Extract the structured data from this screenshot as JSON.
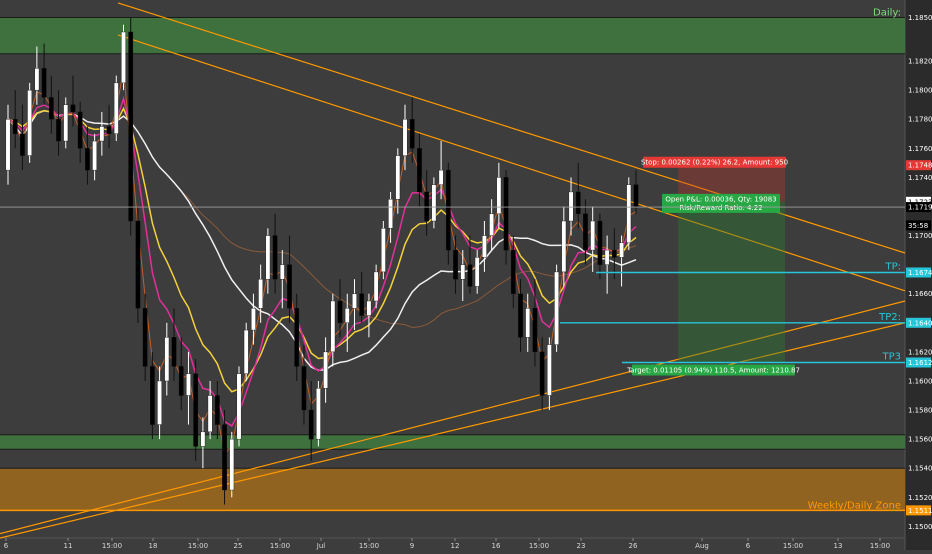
{
  "chart_data": {
    "type": "candlestick",
    "symbol_timeframe_hint": "",
    "y_range": [
      1.1492,
      1.1862
    ],
    "x_ticks": [
      "6",
      "11",
      "15:00",
      "18",
      "21",
      "15:00",
      "25",
      "28",
      "Jul",
      "15:00",
      "9",
      "12",
      "16",
      "15:00",
      "23",
      "26",
      "Aug",
      "6",
      "9",
      "15:00",
      "13",
      "16",
      "15:00"
    ],
    "y_ticks": [
      "1.18500",
      "1.18200",
      "1.18000",
      "1.17800",
      "1.17600",
      "1.17400",
      "1.17200",
      "1.17000",
      "1.16600",
      "1.16400",
      "1.16200",
      "1.16000",
      "1.15800",
      "1.15600",
      "1.15400",
      "1.15200",
      "1.15000"
    ],
    "price_labels": [
      {
        "text": "1.17484",
        "value": 1.17484,
        "color": "#e53935",
        "text_color": "#ffffff"
      },
      {
        "text": "1.17232",
        "value": 1.17232,
        "color": "#ffffff",
        "text_color": "#000000"
      },
      {
        "text": "1.17196",
        "value": 1.17196,
        "color": "#000000",
        "text_color": "#ffffff"
      },
      {
        "text": "35:58",
        "value": 1.1707,
        "color": "#000000",
        "text_color": "#ffffff"
      },
      {
        "text": "1.16746",
        "value": 1.16746,
        "color": "#26c6da",
        "text_color": "#ffffff"
      },
      {
        "text": "1.16400",
        "value": 1.164,
        "color": "#26c6da",
        "text_color": "#ffffff"
      },
      {
        "text": "1.16127",
        "value": 1.16127,
        "color": "#26c6da",
        "text_color": "#ffffff"
      },
      {
        "text": "1.15110",
        "value": 1.1511,
        "color": "#ff9800",
        "text_color": "#ffffff"
      }
    ],
    "zones": [
      {
        "label": "Daily:",
        "top": 1.185,
        "bottom": 1.1825,
        "color": "#3e7a3e",
        "label_color": "#7fdc7f"
      },
      {
        "label": "",
        "top": 1.1563,
        "bottom": 1.1553,
        "color": "#3e7a3e",
        "label_color": ""
      },
      {
        "label": "Weekly/Daily Zone",
        "top": 1.154,
        "bottom": 1.1511,
        "color": "#a06a1c",
        "label_color": "#ff9800"
      }
    ],
    "levels": [
      {
        "label": "TP:",
        "value": 1.16746,
        "color": "#26c6da"
      },
      {
        "label": "TP2:",
        "value": 1.164,
        "color": "#26c6da"
      },
      {
        "label": "TP3",
        "value": 1.16127,
        "color": "#26c6da"
      },
      {
        "label": "",
        "value": 1.1511,
        "color": "#ff9800"
      },
      {
        "label": "",
        "value": 1.17196,
        "color": "#9e9e9e"
      }
    ],
    "trade": {
      "stop_label": "Stop: 0.00262 (0.22%) 26.2, Amount: 950",
      "open_label_1": "Open P&L: 0.00036, Qty: 19083",
      "open_label_2": "Risk/Reward Ratio: 4.22",
      "target_label": "Target: 0.01105 (0.94%) 110.5, Amount: 1210.87",
      "entry": 1.17232,
      "stop": 1.17494,
      "target": 1.16127,
      "start_index": 92,
      "end_index": 112
    },
    "candles_ohlc": [
      [
        1.1745,
        1.179,
        1.1735,
        1.178
      ],
      [
        1.178,
        1.18,
        1.176,
        1.177
      ],
      [
        1.177,
        1.179,
        1.1745,
        1.1755
      ],
      [
        1.1755,
        1.1805,
        1.175,
        1.18
      ],
      [
        1.18,
        1.183,
        1.179,
        1.1815
      ],
      [
        1.1815,
        1.1832,
        1.179,
        1.1795
      ],
      [
        1.1795,
        1.181,
        1.177,
        1.178
      ],
      [
        1.178,
        1.18,
        1.1755,
        1.1765
      ],
      [
        1.1765,
        1.1795,
        1.176,
        1.179
      ],
      [
        1.179,
        1.181,
        1.1775,
        1.1785
      ],
      [
        1.1785,
        1.1792,
        1.175,
        1.176
      ],
      [
        1.176,
        1.1775,
        1.1735,
        1.1745
      ],
      [
        1.1745,
        1.177,
        1.1738,
        1.1765
      ],
      [
        1.1765,
        1.1785,
        1.1755,
        1.1775
      ],
      [
        1.1775,
        1.179,
        1.176,
        1.177
      ],
      [
        1.177,
        1.181,
        1.1765,
        1.1805
      ],
      [
        1.1805,
        1.1845,
        1.18,
        1.184
      ],
      [
        1.184,
        1.185,
        1.17,
        1.171
      ],
      [
        1.171,
        1.172,
        1.164,
        1.165
      ],
      [
        1.165,
        1.166,
        1.16,
        1.161
      ],
      [
        1.161,
        1.162,
        1.156,
        1.157
      ],
      [
        1.157,
        1.161,
        1.156,
        1.16
      ],
      [
        1.16,
        1.164,
        1.159,
        1.163
      ],
      [
        1.163,
        1.165,
        1.16,
        1.161
      ],
      [
        1.161,
        1.163,
        1.158,
        1.159
      ],
      [
        1.159,
        1.162,
        1.157,
        1.1605
      ],
      [
        1.1605,
        1.1615,
        1.1545,
        1.1555
      ],
      [
        1.1555,
        1.1575,
        1.154,
        1.1565
      ],
      [
        1.1565,
        1.16,
        1.156,
        1.159
      ],
      [
        1.159,
        1.16,
        1.156,
        1.157
      ],
      [
        1.157,
        1.158,
        1.1515,
        1.1525
      ],
      [
        1.1525,
        1.1565,
        1.152,
        1.156
      ],
      [
        1.156,
        1.161,
        1.1555,
        1.1605
      ],
      [
        1.1605,
        1.164,
        1.16,
        1.1635
      ],
      [
        1.1635,
        1.166,
        1.1625,
        1.165
      ],
      [
        1.165,
        1.168,
        1.164,
        1.167
      ],
      [
        1.167,
        1.1705,
        1.166,
        1.17
      ],
      [
        1.17,
        1.1715,
        1.166,
        1.167
      ],
      [
        1.167,
        1.169,
        1.165,
        1.168
      ],
      [
        1.168,
        1.17,
        1.164,
        1.165
      ],
      [
        1.165,
        1.166,
        1.16,
        1.161
      ],
      [
        1.161,
        1.1625,
        1.157,
        1.158
      ],
      [
        1.158,
        1.16,
        1.1545,
        1.156
      ],
      [
        1.156,
        1.16,
        1.1555,
        1.1595
      ],
      [
        1.1595,
        1.163,
        1.1585,
        1.162
      ],
      [
        1.162,
        1.166,
        1.161,
        1.1655
      ],
      [
        1.1655,
        1.167,
        1.163,
        1.164
      ],
      [
        1.164,
        1.166,
        1.162,
        1.165
      ],
      [
        1.165,
        1.167,
        1.1635,
        1.166
      ],
      [
        1.166,
        1.1675,
        1.164,
        1.1645
      ],
      [
        1.1645,
        1.166,
        1.163,
        1.1655
      ],
      [
        1.1655,
        1.168,
        1.165,
        1.1675
      ],
      [
        1.1675,
        1.171,
        1.167,
        1.1705
      ],
      [
        1.1705,
        1.173,
        1.1695,
        1.1725
      ],
      [
        1.1725,
        1.176,
        1.1715,
        1.1755
      ],
      [
        1.1755,
        1.179,
        1.1745,
        1.178
      ],
      [
        1.178,
        1.1795,
        1.175,
        1.176
      ],
      [
        1.176,
        1.177,
        1.172,
        1.173
      ],
      [
        1.173,
        1.1745,
        1.17,
        1.171
      ],
      [
        1.171,
        1.174,
        1.1705,
        1.1735
      ],
      [
        1.1735,
        1.1765,
        1.1725,
        1.1745
      ],
      [
        1.1745,
        1.175,
        1.168,
        1.169
      ],
      [
        1.169,
        1.17,
        1.166,
        1.167
      ],
      [
        1.167,
        1.169,
        1.1655,
        1.168
      ],
      [
        1.168,
        1.17,
        1.166,
        1.1665
      ],
      [
        1.1665,
        1.169,
        1.166,
        1.1685
      ],
      [
        1.1685,
        1.171,
        1.1675,
        1.17
      ],
      [
        1.17,
        1.1725,
        1.169,
        1.1715
      ],
      [
        1.1715,
        1.175,
        1.1705,
        1.174
      ],
      [
        1.174,
        1.1745,
        1.168,
        1.169
      ],
      [
        1.169,
        1.17,
        1.165,
        1.166
      ],
      [
        1.166,
        1.167,
        1.162,
        1.163
      ],
      [
        1.163,
        1.166,
        1.162,
        1.165
      ],
      [
        1.165,
        1.167,
        1.161,
        1.162
      ],
      [
        1.162,
        1.163,
        1.158,
        1.159
      ],
      [
        1.159,
        1.163,
        1.158,
        1.1625
      ],
      [
        1.1625,
        1.168,
        1.162,
        1.1675
      ],
      [
        1.1675,
        1.172,
        1.1665,
        1.171
      ],
      [
        1.171,
        1.174,
        1.17,
        1.173
      ],
      [
        1.173,
        1.175,
        1.1705,
        1.1715
      ],
      [
        1.1715,
        1.1725,
        1.168,
        1.169
      ],
      [
        1.169,
        1.172,
        1.1675,
        1.171
      ],
      [
        1.171,
        1.1715,
        1.167,
        1.168
      ],
      [
        1.168,
        1.17,
        1.166,
        1.169
      ],
      [
        1.169,
        1.1705,
        1.167,
        1.1685
      ],
      [
        1.1685,
        1.17,
        1.1665,
        1.1695
      ],
      [
        1.1695,
        1.174,
        1.169,
        1.1735
      ],
      [
        1.1735,
        1.1745,
        1.1715,
        1.172
      ]
    ]
  }
}
